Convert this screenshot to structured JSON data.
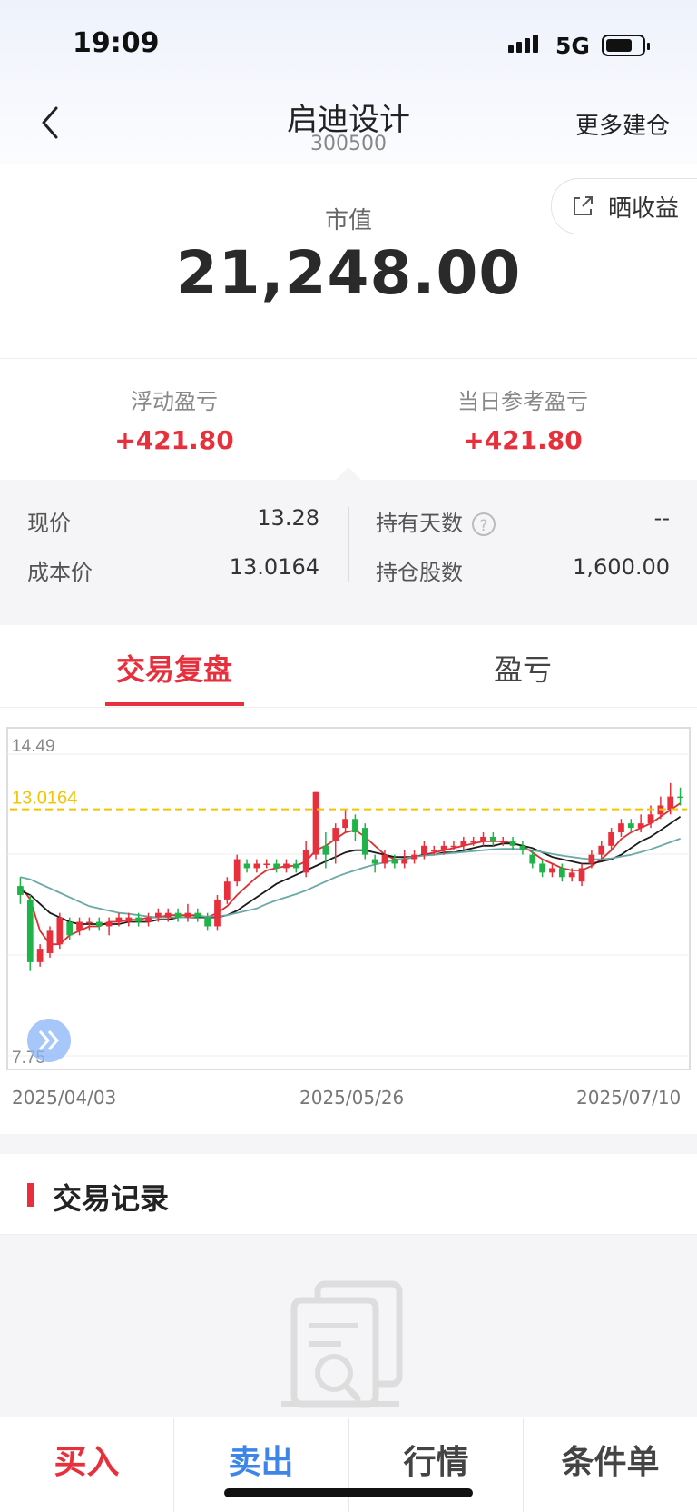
{
  "status": {
    "time": "19:09",
    "network": "5G"
  },
  "nav": {
    "title": "启迪设计",
    "code": "300500",
    "more": "更多建仓"
  },
  "share": {
    "label": "晒收益",
    "icon": "share-icon"
  },
  "market_value": {
    "label": "市值",
    "value": "21,248.00"
  },
  "pnl": {
    "floating_label": "浮动盈亏",
    "floating_value": "+421.80",
    "daily_label": "当日参考盈亏",
    "daily_value": "+421.80",
    "color": "#e8303c"
  },
  "stats": {
    "price_label": "现价",
    "price_value": "13.28",
    "cost_label": "成本价",
    "cost_value": "13.0164",
    "days_label": "持有天数",
    "days_value": "--",
    "shares_label": "持仓股数",
    "shares_value": "1,600.00"
  },
  "tabs": [
    "交易复盘",
    "盈亏"
  ],
  "chart_data": {
    "type": "candlestick",
    "y_max_label": "14.49",
    "y_min_label": "7.75",
    "ylim": [
      7.75,
      14.49
    ],
    "cost_line": {
      "value": 13.0164,
      "label": "13.0164",
      "color": "#f5c400"
    },
    "x_labels": [
      "2025/04/03",
      "2025/05/26",
      "2025/07/10"
    ],
    "up_color": "#e8303c",
    "down_color": "#1fb34a",
    "candles": [
      [
        11.3,
        11.1,
        11.5,
        10.9
      ],
      [
        11.0,
        9.6,
        11.1,
        9.4
      ],
      [
        9.6,
        9.9,
        10.0,
        9.5
      ],
      [
        9.8,
        10.3,
        10.4,
        9.7
      ],
      [
        10.0,
        10.6,
        10.7,
        9.9
      ],
      [
        10.5,
        10.2,
        10.6,
        10.1
      ],
      [
        10.3,
        10.5,
        10.6,
        10.2
      ],
      [
        10.5,
        10.5,
        10.6,
        10.3
      ],
      [
        10.5,
        10.4,
        10.6,
        10.3
      ],
      [
        10.4,
        10.5,
        10.6,
        10.2
      ],
      [
        10.5,
        10.6,
        10.7,
        10.4
      ],
      [
        10.5,
        10.6,
        10.7,
        10.4
      ],
      [
        10.6,
        10.5,
        10.7,
        10.4
      ],
      [
        10.5,
        10.6,
        10.7,
        10.4
      ],
      [
        10.6,
        10.7,
        10.8,
        10.5
      ],
      [
        10.6,
        10.7,
        10.8,
        10.5
      ],
      [
        10.7,
        10.6,
        10.8,
        10.5
      ],
      [
        10.6,
        10.7,
        10.9,
        10.5
      ],
      [
        10.7,
        10.6,
        10.8,
        10.5
      ],
      [
        10.6,
        10.4,
        10.7,
        10.3
      ],
      [
        10.4,
        11.0,
        11.1,
        10.3
      ],
      [
        11.0,
        11.4,
        11.5,
        10.9
      ],
      [
        11.4,
        11.9,
        12.0,
        11.3
      ],
      [
        11.8,
        11.7,
        11.9,
        11.6
      ],
      [
        11.7,
        11.8,
        11.9,
        11.6
      ],
      [
        11.8,
        11.8,
        11.9,
        11.7
      ],
      [
        11.8,
        11.7,
        11.9,
        11.6
      ],
      [
        11.7,
        11.8,
        11.9,
        11.6
      ],
      [
        11.8,
        11.7,
        11.9,
        11.6
      ],
      [
        11.6,
        12.1,
        12.3,
        11.5
      ],
      [
        12.0,
        13.4,
        13.4,
        11.9
      ],
      [
        12.2,
        12.0,
        12.5,
        11.7
      ],
      [
        12.3,
        12.6,
        12.7,
        11.8
      ],
      [
        12.6,
        12.8,
        13.0,
        12.5
      ],
      [
        12.8,
        12.5,
        12.9,
        12.3
      ],
      [
        12.6,
        12.0,
        12.7,
        11.9
      ],
      [
        11.9,
        11.8,
        12.0,
        11.6
      ],
      [
        11.8,
        12.0,
        12.1,
        11.7
      ],
      [
        11.9,
        11.8,
        12.0,
        11.7
      ],
      [
        11.8,
        11.9,
        12.1,
        11.7
      ],
      [
        11.9,
        12.0,
        12.1,
        11.8
      ],
      [
        12.0,
        12.2,
        12.3,
        11.9
      ],
      [
        12.1,
        12.1,
        12.2,
        12.0
      ],
      [
        12.1,
        12.2,
        12.3,
        12.0
      ],
      [
        12.2,
        12.2,
        12.3,
        12.1
      ],
      [
        12.2,
        12.3,
        12.4,
        12.1
      ],
      [
        12.3,
        12.3,
        12.4,
        12.2
      ],
      [
        12.3,
        12.4,
        12.5,
        12.2
      ],
      [
        12.4,
        12.3,
        12.5,
        12.2
      ],
      [
        12.3,
        12.3,
        12.4,
        12.2
      ],
      [
        12.3,
        12.2,
        12.4,
        12.1
      ],
      [
        12.2,
        12.1,
        12.3,
        12.0
      ],
      [
        12.0,
        11.8,
        12.1,
        11.7
      ],
      [
        11.8,
        11.6,
        11.9,
        11.5
      ],
      [
        11.6,
        11.7,
        11.8,
        11.5
      ],
      [
        11.7,
        11.5,
        11.8,
        11.4
      ],
      [
        11.5,
        11.6,
        11.7,
        11.4
      ],
      [
        11.4,
        11.7,
        11.8,
        11.3
      ],
      [
        11.8,
        12.0,
        12.1,
        11.7
      ],
      [
        12.0,
        12.2,
        12.3,
        11.9
      ],
      [
        12.2,
        12.5,
        12.6,
        12.1
      ],
      [
        12.5,
        12.7,
        12.8,
        12.4
      ],
      [
        12.7,
        12.6,
        12.8,
        12.5
      ],
      [
        12.6,
        12.7,
        12.9,
        12.5
      ],
      [
        12.7,
        12.9,
        13.1,
        12.6
      ],
      [
        12.9,
        13.1,
        13.3,
        12.8
      ],
      [
        13.0,
        13.3,
        13.6,
        12.9
      ],
      [
        13.3,
        13.28,
        13.5,
        13.1
      ]
    ],
    "ma_lines": [
      {
        "color": "#d93030",
        "values": [
          11.3,
          11.0,
          10.3,
          10.0,
          10.0,
          10.2,
          10.3,
          10.4,
          10.4,
          10.5,
          10.5,
          10.55,
          10.55,
          10.6,
          10.6,
          10.65,
          10.65,
          10.65,
          10.65,
          10.6,
          10.7,
          10.85,
          11.1,
          11.3,
          11.5,
          11.65,
          11.7,
          11.75,
          11.75,
          11.85,
          12.1,
          12.2,
          12.35,
          12.5,
          12.55,
          12.4,
          12.2,
          12.0,
          11.9,
          11.9,
          11.95,
          12.0,
          12.05,
          12.1,
          12.15,
          12.2,
          12.25,
          12.3,
          12.3,
          12.3,
          12.25,
          12.2,
          12.05,
          11.9,
          11.8,
          11.7,
          11.65,
          11.65,
          11.75,
          11.9,
          12.1,
          12.35,
          12.5,
          12.6,
          12.7,
          12.85,
          13.0,
          13.15
        ]
      },
      {
        "color": "#1a1a1a",
        "values": [
          11.2,
          11.1,
          10.9,
          10.7,
          10.6,
          10.5,
          10.45,
          10.45,
          10.45,
          10.45,
          10.45,
          10.5,
          10.5,
          10.5,
          10.55,
          10.55,
          10.6,
          10.6,
          10.6,
          10.6,
          10.6,
          10.65,
          10.75,
          10.9,
          11.05,
          11.2,
          11.35,
          11.45,
          11.55,
          11.65,
          11.75,
          11.85,
          11.95,
          12.05,
          12.1,
          12.1,
          12.05,
          12.0,
          11.95,
          11.95,
          11.95,
          12.0,
          12.0,
          12.05,
          12.05,
          12.1,
          12.15,
          12.2,
          12.2,
          12.25,
          12.25,
          12.2,
          12.15,
          12.05,
          11.95,
          11.9,
          11.85,
          11.8,
          11.8,
          11.85,
          11.9,
          12.0,
          12.15,
          12.3,
          12.4,
          12.55,
          12.7,
          12.85
        ]
      },
      {
        "color": "#6aa9a6",
        "values": [
          11.5,
          11.45,
          11.35,
          11.25,
          11.15,
          11.05,
          10.95,
          10.85,
          10.8,
          10.75,
          10.7,
          10.68,
          10.65,
          10.62,
          10.6,
          10.6,
          10.6,
          10.6,
          10.62,
          10.62,
          10.62,
          10.65,
          10.7,
          10.75,
          10.8,
          10.9,
          10.98,
          11.05,
          11.12,
          11.2,
          11.3,
          11.4,
          11.5,
          11.58,
          11.65,
          11.72,
          11.78,
          11.83,
          11.88,
          11.92,
          11.95,
          11.98,
          12.0,
          12.02,
          12.04,
          12.06,
          12.08,
          12.1,
          12.12,
          12.13,
          12.13,
          12.12,
          12.1,
          12.06,
          12.02,
          11.98,
          11.95,
          11.92,
          11.9,
          11.9,
          11.92,
          11.96,
          12.0,
          12.06,
          12.12,
          12.2,
          12.28,
          12.36
        ]
      }
    ]
  },
  "records": {
    "title": "交易记录"
  },
  "bottom": {
    "buy": "买入",
    "sell": "卖出",
    "quote": "行情",
    "condition": "条件单",
    "buy_color": "#e8303c",
    "sell_color": "#3d86e8"
  }
}
